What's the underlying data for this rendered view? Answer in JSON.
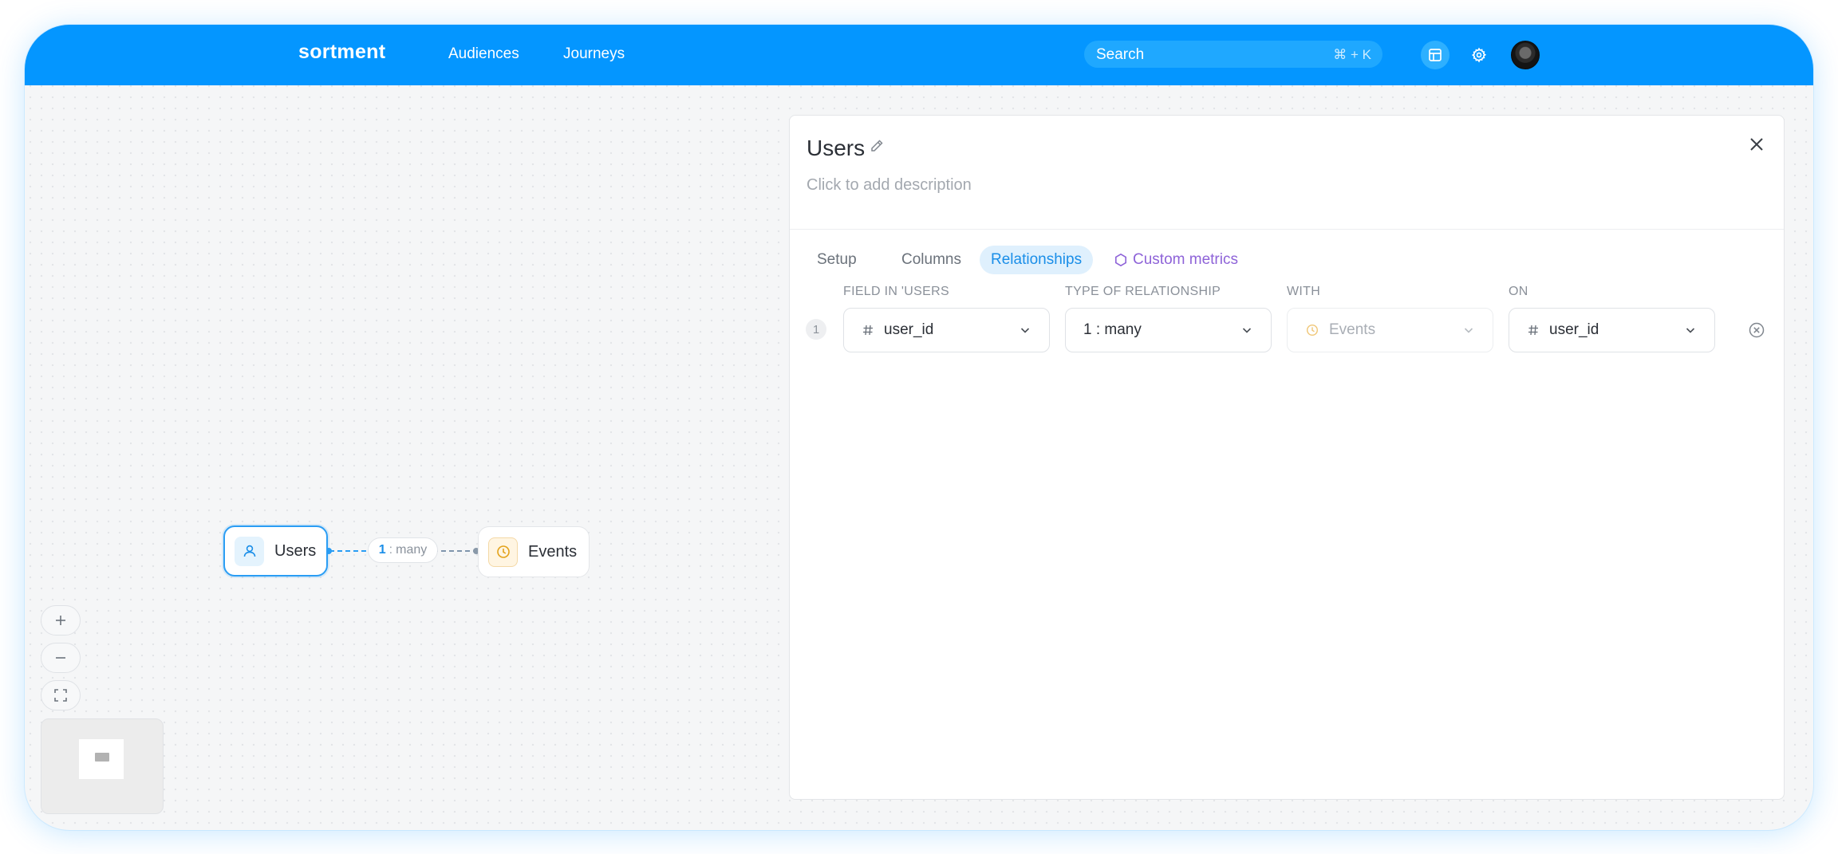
{
  "header": {
    "logo": "sortment",
    "nav": [
      "Audiences",
      "Journeys"
    ],
    "search": {
      "label": "Search",
      "shortcut": "⌘ + K"
    },
    "icons": [
      "table-icon",
      "gear-icon"
    ],
    "accent_color": "#0496ff"
  },
  "canvas": {
    "nodes": [
      {
        "label": "Users",
        "icon": "user-icon",
        "selected": true
      },
      {
        "label": "Events",
        "icon": "clock-icon",
        "selected": false
      }
    ],
    "edge": {
      "left": "1",
      "separator": ":",
      "right": "many"
    },
    "controls": [
      "zoom-in",
      "zoom-out",
      "fit-view"
    ]
  },
  "panel": {
    "title": "Users",
    "description_placeholder": "Click to add description",
    "tabs": [
      "Setup",
      "Columns",
      "Relationships",
      "Custom metrics"
    ],
    "active_tab": "Relationships",
    "columns": [
      "FIELD IN 'USERS",
      "TYPE OF RELATIONSHIP",
      "WITH",
      "ON"
    ],
    "rows": [
      {
        "index": "1",
        "field": "user_id",
        "type": "1 : many",
        "with": "Events",
        "on": "user_id"
      }
    ]
  }
}
